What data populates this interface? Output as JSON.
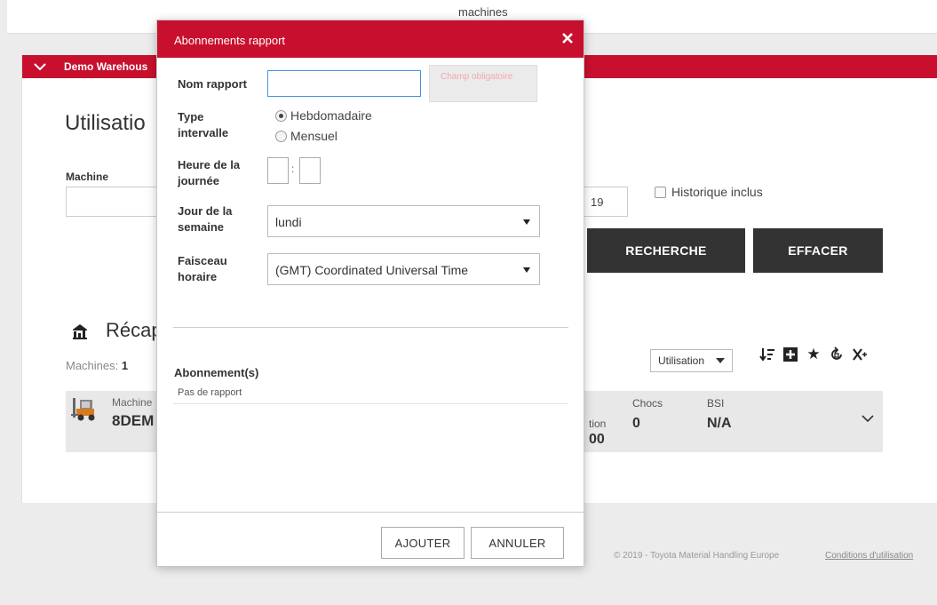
{
  "window": {
    "title": "machines"
  },
  "warehouse": {
    "name": "Demo Warehous"
  },
  "page": {
    "title": "Utilisatio",
    "machine_label": "Machine",
    "date_value": "19",
    "history_label": "Historique inclus",
    "search_button": "RECHERCHE",
    "clear_button": "EFFACER"
  },
  "summary": {
    "title": "Récap",
    "machines_label": "Machines:",
    "machines_count": "1",
    "sort_select": "Utilisation",
    "toolbar_icons": [
      "sort-icon",
      "add-square-icon",
      "star-icon",
      "refresh-icon",
      "excel-export-icon"
    ]
  },
  "machine_row": {
    "name_label": "Machine",
    "name": "8DEM",
    "tion_label": "tion",
    "tion_value": "00",
    "chocs_label": "Chocs",
    "chocs_value": "0",
    "bsi_label": "BSI",
    "bsi_value": "N/A"
  },
  "footer": {
    "copyright": "© 2019 - Toyota Material Handling Europe",
    "terms": "Conditions d'utilisation"
  },
  "modal": {
    "title": "Abonnements rapport",
    "name_label": "Nom rapport",
    "name_value": "",
    "required_tip": "Champ obligatoire",
    "type_label": "Type intervalle",
    "type_options": [
      "Hebdomadaire",
      "Mensuel"
    ],
    "type_selected": "Hebdomadaire",
    "hour_label": "Heure de la journée",
    "hour_separator": ":",
    "day_label": "Jour de la semaine",
    "day_value": "lundi",
    "tz_label": "Faisceau horaire",
    "tz_value": "(GMT) Coordinated Universal Time",
    "subs_title": "Abonnement(s)",
    "subs_empty": "Pas de rapport",
    "add_button": "AJOUTER",
    "cancel_button": "ANNULER"
  },
  "colors": {
    "brand": "#c8102e",
    "dark_button": "#333333",
    "focus": "#4a90e2"
  }
}
